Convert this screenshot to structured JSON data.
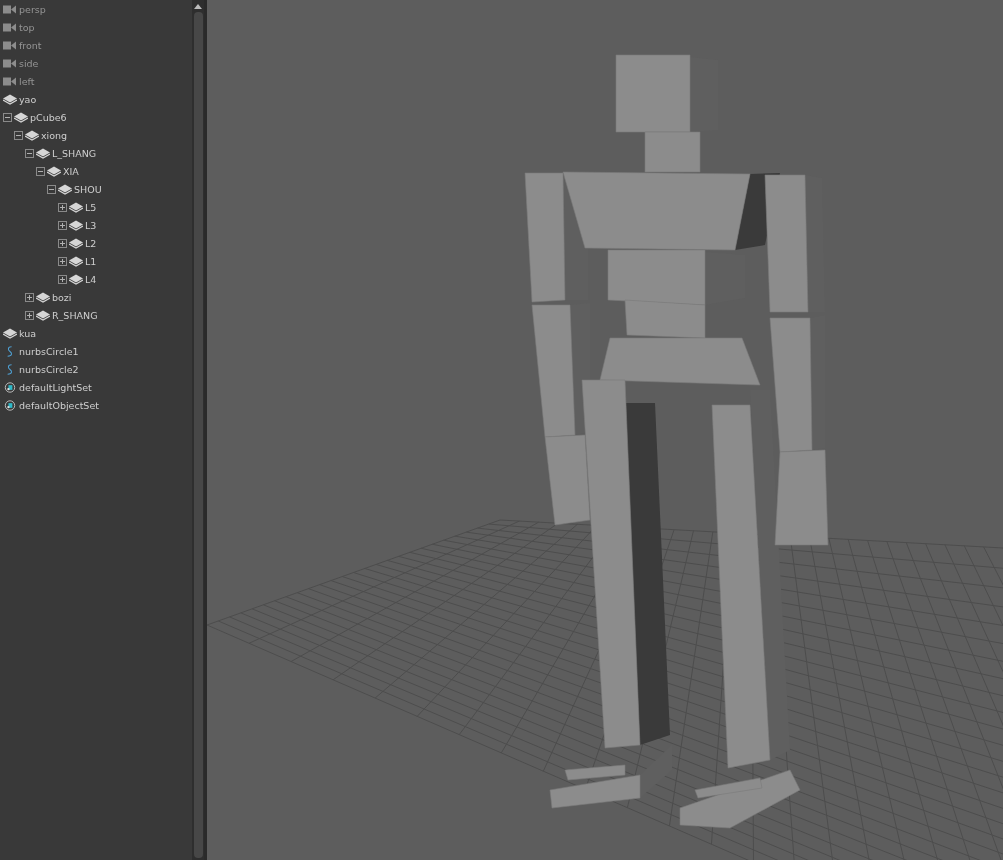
{
  "outliner": {
    "items": [
      {
        "label": "persp",
        "kind": "camera",
        "dimmed": true
      },
      {
        "label": "top",
        "kind": "camera",
        "dimmed": true
      },
      {
        "label": "front",
        "kind": "camera",
        "dimmed": true
      },
      {
        "label": "side",
        "kind": "camera",
        "dimmed": true
      },
      {
        "label": "left",
        "kind": "camera",
        "dimmed": true
      },
      {
        "label": "yao",
        "kind": "mesh",
        "dimmed": false
      },
      {
        "label": "pCube6",
        "kind": "mesh",
        "dimmed": false,
        "expanded": true,
        "children": [
          {
            "label": "xiong",
            "kind": "mesh",
            "dimmed": false,
            "expanded": true,
            "children": [
              {
                "label": "L_SHANG",
                "kind": "mesh",
                "dimmed": false,
                "expanded": true,
                "children": [
                  {
                    "label": "XIA",
                    "kind": "mesh",
                    "dimmed": false,
                    "expanded": true,
                    "children": [
                      {
                        "label": "SHOU",
                        "kind": "mesh",
                        "dimmed": false,
                        "expanded": true,
                        "children": [
                          {
                            "label": "L5",
                            "kind": "mesh",
                            "dimmed": false,
                            "expanded": false
                          },
                          {
                            "label": "L3",
                            "kind": "mesh",
                            "dimmed": false,
                            "expanded": false
                          },
                          {
                            "label": "L2",
                            "kind": "mesh",
                            "dimmed": false,
                            "expanded": false
                          },
                          {
                            "label": "L1",
                            "kind": "mesh",
                            "dimmed": false,
                            "expanded": false
                          },
                          {
                            "label": "L4",
                            "kind": "mesh",
                            "dimmed": false,
                            "expanded": false
                          }
                        ]
                      }
                    ]
                  }
                ]
              },
              {
                "label": "bozi",
                "kind": "mesh",
                "dimmed": false,
                "expanded": false
              },
              {
                "label": "R_SHANG",
                "kind": "mesh",
                "dimmed": false,
                "expanded": false
              }
            ]
          }
        ]
      },
      {
        "label": "kua",
        "kind": "mesh",
        "dimmed": false
      },
      {
        "label": "nurbsCircle1",
        "kind": "curve",
        "dimmed": false
      },
      {
        "label": "nurbsCircle2",
        "kind": "curve",
        "dimmed": false
      },
      {
        "label": "defaultLightSet",
        "kind": "set",
        "dimmed": false
      },
      {
        "label": "defaultObjectSet",
        "kind": "set",
        "dimmed": false
      }
    ]
  }
}
